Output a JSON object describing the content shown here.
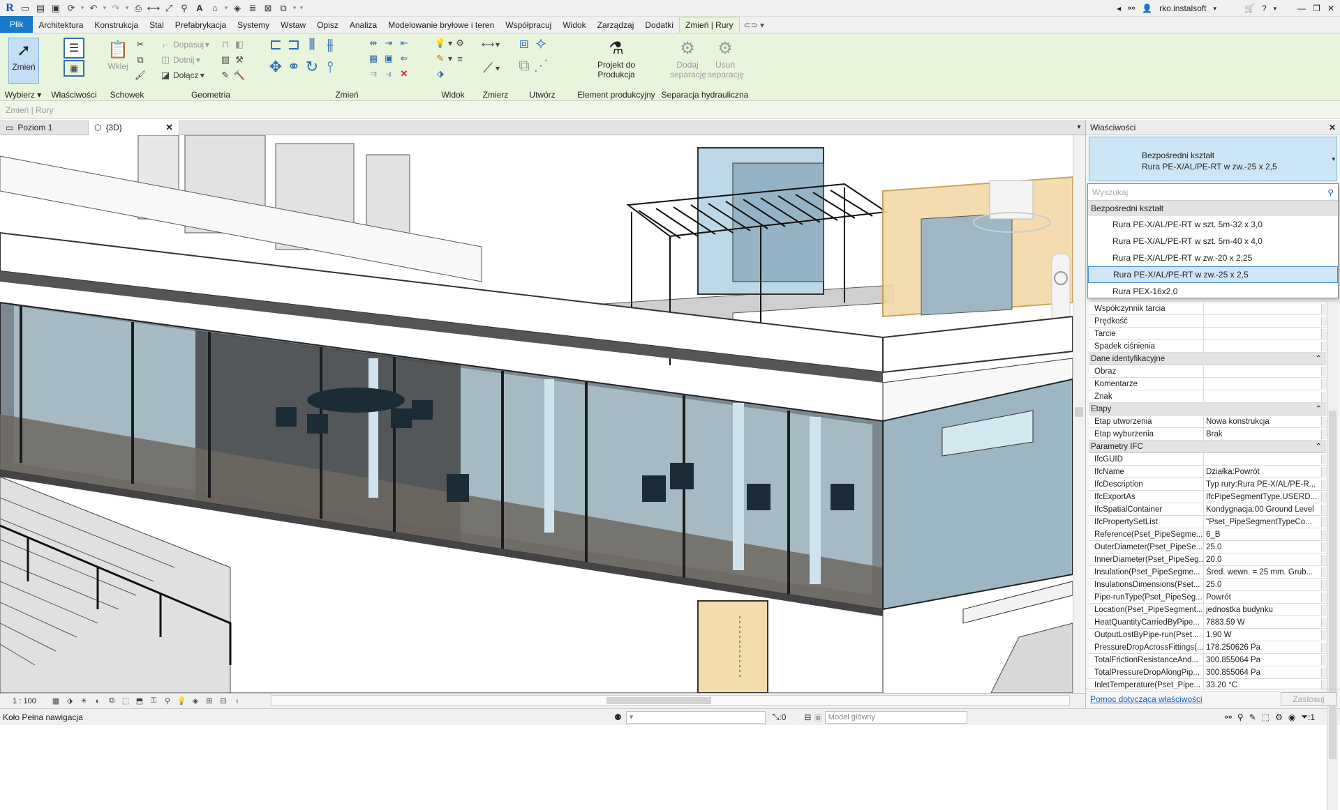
{
  "title_bar": {
    "user": "rko.instalsoft"
  },
  "ribbon_tabs": [
    "Plik",
    "Architektura",
    "Konstrukcja",
    "Stal",
    "Prefabrykacja",
    "Systemy",
    "Wstaw",
    "Opisz",
    "Analiza",
    "Modelowanie bryłowe i teren",
    "Współpracuj",
    "Widok",
    "Zarządzaj",
    "Dodatki",
    "Zmień | Rury"
  ],
  "ribbon": {
    "select_panel": {
      "modify_label": "Zmień",
      "panel_label": "Wybierz ▾"
    },
    "properties_panel": {
      "panel_label": "Właściwości"
    },
    "clipboard_panel": {
      "paste_label": "Wklej",
      "panel_label": "Schowek"
    },
    "geometry_panel": {
      "cope_label": "Dopasuj",
      "cut_label": "Dotnij",
      "join_label": "Dołącz",
      "panel_label": "Geometria"
    },
    "modify_panel": {
      "panel_label": "Zmień"
    },
    "view_panel": {
      "panel_label": "Widok"
    },
    "measure_panel": {
      "panel_label": "Zmierz"
    },
    "create_panel": {
      "panel_label": "Utwórz"
    },
    "fabrication_panel": {
      "button_label": "Projekt do Produkcja",
      "panel_label": "Element produkcyjny"
    },
    "hydraulic_panel": {
      "add_label": "Dodaj separację",
      "remove_label": "Usuń separację",
      "panel_label": "Separacja hydrauliczna"
    }
  },
  "options_bar": {
    "text": "Zmień | Rury"
  },
  "view_tabs": [
    {
      "label": "Poziom 1"
    },
    {
      "label": "{3D}"
    }
  ],
  "view_bar": {
    "scale": "1 : 100"
  },
  "status_bar": {
    "text": "Koło Pełna nawigacja",
    "selection_count": ":0",
    "workset": "Model główny",
    "filter_count": ":1"
  },
  "properties": {
    "header": "Właściwości",
    "type_family": "Bezpośredni kształt",
    "type_name": "Rura PE-X/AL/PE-RT w zw.-25 x 2,5",
    "search_placeholder": "Wyszukaj",
    "dropdown": {
      "group": "Bezpośredni kształt",
      "items": [
        "Rura PE-X/AL/PE-RT w szt. 5m-32 x 3,0",
        "Rura PE-X/AL/PE-RT w szt. 5m-40 x 4,0",
        "Rura PE-X/AL/PE-RT w zw.-20 x 2,25",
        "Rura PE-X/AL/PE-RT w zw.-25 x 2,5",
        "Rura PEX-16x2.0"
      ],
      "selected_index": 3
    },
    "rows_top": [
      {
        "k": "Współczynnik tarcia",
        "v": ""
      },
      {
        "k": "Prędkość",
        "v": ""
      },
      {
        "k": "Tarcie",
        "v": ""
      },
      {
        "k": "Spadek ciśnienia",
        "v": ""
      }
    ],
    "group_identity": "Dane identyfikacyjne",
    "rows_identity": [
      {
        "k": "Obraz",
        "v": ""
      },
      {
        "k": "Komentarze",
        "v": ""
      },
      {
        "k": "Znak",
        "v": ""
      }
    ],
    "group_phases": "Etapy",
    "rows_phases": [
      {
        "k": "Etap utworzenia",
        "v": "Nowa konstrukcja"
      },
      {
        "k": "Etap wyburzenia",
        "v": "Brak"
      }
    ],
    "group_ifc": "Parametry IFC",
    "rows_ifc": [
      {
        "k": "IfcGUID",
        "v": ""
      },
      {
        "k": "IfcName",
        "v": "Działka:Powrót"
      },
      {
        "k": "IfcDescription",
        "v": "Typ rury:Rura PE-X/AL/PE-R..."
      },
      {
        "k": "IfcExportAs",
        "v": "IfcPipeSegmentType.USERD..."
      },
      {
        "k": "IfcSpatialContainer",
        "v": "Kondygnacja:00 Ground Level"
      },
      {
        "k": "IfcPropertySetList",
        "v": "\"Pset_PipeSegmentTypeCo..."
      },
      {
        "k": "Reference(Pset_PipeSegme...",
        "v": "6_B"
      },
      {
        "k": "OuterDiameter(Pset_PipeSe...",
        "v": "25.0"
      },
      {
        "k": "InnerDiameter(Pset_PipeSeg...",
        "v": "20.0"
      },
      {
        "k": "Insulation(Pset_PipeSegme...",
        "v": "Śred. wewn. = 25 mm. Grub..."
      },
      {
        "k": "InsulationsDimensions(Pset...",
        "v": "25.0"
      },
      {
        "k": "Pipe-runType(Pset_PipeSeg...",
        "v": "Powrót"
      },
      {
        "k": "Location(Pset_PipeSegment...",
        "v": "jednostka budynku"
      },
      {
        "k": "HeatQuantityCarriedByPipe...",
        "v": "7883.59 W"
      },
      {
        "k": "OutputLostByPipe-run(Pset...",
        "v": "1.90 W"
      },
      {
        "k": "PressureDropAcrossFittings(...",
        "v": "178.250626 Pa"
      },
      {
        "k": "TotalFrictionResistanceAnd...",
        "v": "300.855064 Pa"
      },
      {
        "k": "TotalPressureDropAlongPip...",
        "v": "300.855064 Pa"
      },
      {
        "k": "InletTemperature(Pset_Pipe...",
        "v": "33.20 °C"
      }
    ],
    "help_link": "Pomoc dotycząca właściwości",
    "apply_label": "Zastosuj"
  }
}
